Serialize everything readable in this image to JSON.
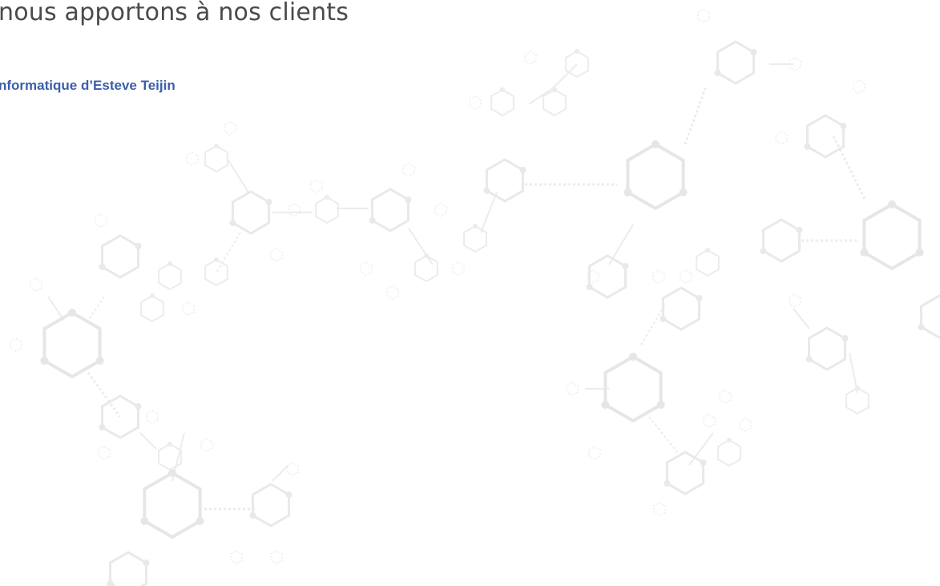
{
  "testimonial": {
    "quote_text": "nous apportons à nos clients",
    "attribution": "nformatique d’Esteve Teijin"
  },
  "colors": {
    "background": "#ffffff",
    "quote_text": "#4a4a4a",
    "attribution": "#3b5fa8",
    "pattern": "#e9e9e9"
  },
  "decorations": {
    "background_pattern": "molecule-hexagon-pattern",
    "quote_icon": "closing-quote-icon"
  }
}
